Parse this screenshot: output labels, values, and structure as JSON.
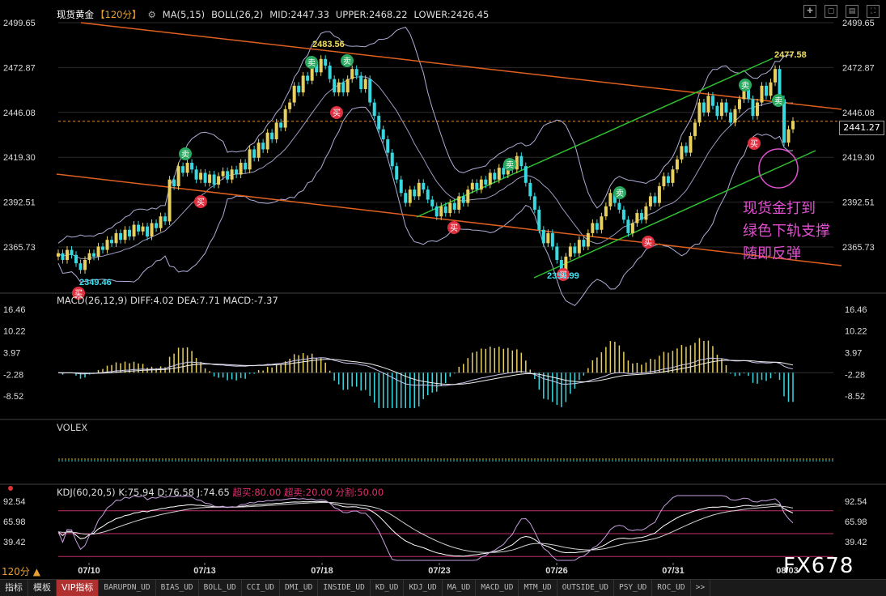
{
  "header": {
    "symbol": "现货黄金",
    "period": "【120分】",
    "ma": "MA(5,15)",
    "boll": "BOLL(26,2)",
    "mid": "MID:2447.33",
    "upper": "UPPER:2468.22",
    "lower": "LOWER:2426.45"
  },
  "price_axis": {
    "ticks": [
      "2499.65",
      "2472.87",
      "2446.08",
      "2419.30",
      "2392.51",
      "2365.73"
    ],
    "current_price": "2441.27"
  },
  "macd": {
    "label": "MACD(26,12,9)",
    "diff": "DIFF:4.02",
    "dea": "DEA:7.71",
    "macd": "MACD:-7.37",
    "ticks": [
      "16.46",
      "10.22",
      "3.97",
      "-2.28",
      "-8.52"
    ]
  },
  "volex": {
    "label": "VOLEX"
  },
  "kdj": {
    "label": "KDJ(60,20,5)",
    "k": "K:75.94",
    "d": "D:76.58",
    "j": "J:74.65",
    "overbought": "超买:80.00",
    "oversold": "超卖:20.00",
    "split": "分割:50.00",
    "ticks": [
      "92.54",
      "65.98",
      "39.42"
    ]
  },
  "date_axis": [
    "07/10",
    "07/13",
    "07/18",
    "07/23",
    "07/26",
    "07/31",
    "08/03"
  ],
  "annotations": {
    "high_left": "2483.56",
    "high_right": "2477.58",
    "low_left": "2349.46",
    "low_mid": "2353.99",
    "buy": "买",
    "sell": "卖",
    "note_lines": [
      "现货金打到",
      "绿色下轨支撑",
      "随即反弹"
    ]
  },
  "period_indicator": "120分 ▲",
  "watermark": "FX678",
  "tabs": [
    "指标",
    "模板",
    "VIP指标",
    "BARUPDN_UD",
    "BIAS_UD",
    "BOLL_UD",
    "CCI_UD",
    "DMI_UD",
    "INSIDE_UD",
    "KD_UD",
    "KDJ_UD",
    "MA_UD",
    "MACD_UD",
    "MTM_UD",
    "OUTSIDE_UD",
    "PSY_UD",
    "ROC_UD",
    ">>"
  ],
  "colors": {
    "up": "#e8d060",
    "down": "#38d8e0",
    "channel_orange": "#e06020",
    "channel_green": "#30c030",
    "boll": "#c0c0f0",
    "buy_red": "#e03040",
    "sell_green": "#2aa860",
    "note": "#e050d0"
  },
  "chart_data": {
    "type": "candlestick",
    "candles": [
      [
        2360,
        2362
      ],
      [
        2362,
        2358
      ],
      [
        2358,
        2364
      ],
      [
        2364,
        2361
      ],
      [
        2361,
        2356
      ],
      [
        2356,
        2352
      ],
      [
        2352,
        2358
      ],
      [
        2358,
        2362
      ],
      [
        2362,
        2360
      ],
      [
        2360,
        2366
      ],
      [
        2366,
        2364
      ],
      [
        2364,
        2370
      ],
      [
        2370,
        2368
      ],
      [
        2368,
        2374
      ],
      [
        2374,
        2370
      ],
      [
        2370,
        2376
      ],
      [
        2376,
        2372
      ],
      [
        2372,
        2379
      ],
      [
        2379,
        2375
      ],
      [
        2375,
        2378
      ],
      [
        2378,
        2372
      ],
      [
        2372,
        2380
      ],
      [
        2380,
        2377
      ],
      [
        2377,
        2384
      ],
      [
        2384,
        2381
      ],
      [
        2381,
        2406
      ],
      [
        2406,
        2402
      ],
      [
        2402,
        2414
      ],
      [
        2414,
        2410
      ],
      [
        2410,
        2416
      ],
      [
        2416,
        2412
      ],
      [
        2412,
        2406
      ],
      [
        2406,
        2410
      ],
      [
        2410,
        2404
      ],
      [
        2404,
        2409
      ],
      [
        2409,
        2403
      ],
      [
        2403,
        2408
      ],
      [
        2408,
        2411
      ],
      [
        2411,
        2406
      ],
      [
        2406,
        2412
      ],
      [
        2412,
        2409
      ],
      [
        2409,
        2416
      ],
      [
        2416,
        2412
      ],
      [
        2412,
        2424
      ],
      [
        2424,
        2419
      ],
      [
        2419,
        2428
      ],
      [
        2428,
        2424
      ],
      [
        2424,
        2434
      ],
      [
        2434,
        2430
      ],
      [
        2430,
        2440
      ],
      [
        2440,
        2437
      ],
      [
        2437,
        2448
      ],
      [
        2448,
        2452
      ],
      [
        2452,
        2462
      ],
      [
        2462,
        2458
      ],
      [
        2458,
        2468
      ],
      [
        2468,
        2465
      ],
      [
        2465,
        2476
      ],
      [
        2476,
        2470
      ],
      [
        2470,
        2478
      ],
      [
        2478,
        2474
      ],
      [
        2474,
        2466
      ],
      [
        2466,
        2458
      ],
      [
        2458,
        2464
      ],
      [
        2464,
        2458
      ],
      [
        2458,
        2466
      ],
      [
        2466,
        2472
      ],
      [
        2472,
        2468
      ],
      [
        2468,
        2460
      ],
      [
        2460,
        2466
      ],
      [
        2466,
        2452
      ],
      [
        2452,
        2444
      ],
      [
        2444,
        2436
      ],
      [
        2436,
        2430
      ],
      [
        2430,
        2422
      ],
      [
        2422,
        2414
      ],
      [
        2414,
        2406
      ],
      [
        2406,
        2398
      ],
      [
        2398,
        2392
      ],
      [
        2392,
        2400
      ],
      [
        2400,
        2396
      ],
      [
        2396,
        2404
      ],
      [
        2404,
        2400
      ],
      [
        2400,
        2394
      ],
      [
        2394,
        2390
      ],
      [
        2390,
        2384
      ],
      [
        2384,
        2390
      ],
      [
        2390,
        2386
      ],
      [
        2386,
        2392
      ],
      [
        2392,
        2388
      ],
      [
        2388,
        2396
      ],
      [
        2396,
        2392
      ],
      [
        2392,
        2400
      ],
      [
        2400,
        2404
      ],
      [
        2404,
        2400
      ],
      [
        2400,
        2406
      ],
      [
        2406,
        2403
      ],
      [
        2403,
        2410
      ],
      [
        2410,
        2406
      ],
      [
        2406,
        2413
      ],
      [
        2413,
        2409
      ],
      [
        2409,
        2416
      ],
      [
        2416,
        2412
      ],
      [
        2412,
        2420
      ],
      [
        2420,
        2414
      ],
      [
        2414,
        2404
      ],
      [
        2404,
        2396
      ],
      [
        2396,
        2388
      ],
      [
        2388,
        2376
      ],
      [
        2376,
        2368
      ],
      [
        2368,
        2374
      ],
      [
        2374,
        2366
      ],
      [
        2366,
        2358
      ],
      [
        2358,
        2352
      ],
      [
        2352,
        2360
      ],
      [
        2360,
        2366
      ],
      [
        2366,
        2362
      ],
      [
        2362,
        2370
      ],
      [
        2370,
        2366
      ],
      [
        2366,
        2374
      ],
      [
        2374,
        2380
      ],
      [
        2380,
        2376
      ],
      [
        2376,
        2384
      ],
      [
        2384,
        2390
      ],
      [
        2390,
        2398
      ],
      [
        2398,
        2392
      ],
      [
        2392,
        2388
      ],
      [
        2388,
        2382
      ],
      [
        2382,
        2374
      ],
      [
        2374,
        2380
      ],
      [
        2380,
        2386
      ],
      [
        2386,
        2382
      ],
      [
        2382,
        2390
      ],
      [
        2390,
        2396
      ],
      [
        2396,
        2392
      ],
      [
        2392,
        2402
      ],
      [
        2402,
        2408
      ],
      [
        2408,
        2404
      ],
      [
        2404,
        2412
      ],
      [
        2412,
        2418
      ],
      [
        2418,
        2426
      ],
      [
        2426,
        2422
      ],
      [
        2422,
        2432
      ],
      [
        2432,
        2440
      ],
      [
        2440,
        2452
      ],
      [
        2452,
        2446
      ],
      [
        2446,
        2456
      ],
      [
        2456,
        2450
      ],
      [
        2450,
        2444
      ],
      [
        2444,
        2452
      ],
      [
        2452,
        2446
      ],
      [
        2446,
        2440
      ],
      [
        2440,
        2448
      ],
      [
        2448,
        2454
      ],
      [
        2454,
        2460
      ],
      [
        2460,
        2454
      ],
      [
        2454,
        2444
      ],
      [
        2444,
        2452
      ],
      [
        2452,
        2462
      ],
      [
        2462,
        2456
      ],
      [
        2456,
        2464
      ],
      [
        2464,
        2472
      ],
      [
        2472,
        2454
      ],
      [
        2454,
        2428
      ],
      [
        2428,
        2436
      ],
      [
        2436,
        2441
      ]
    ]
  }
}
